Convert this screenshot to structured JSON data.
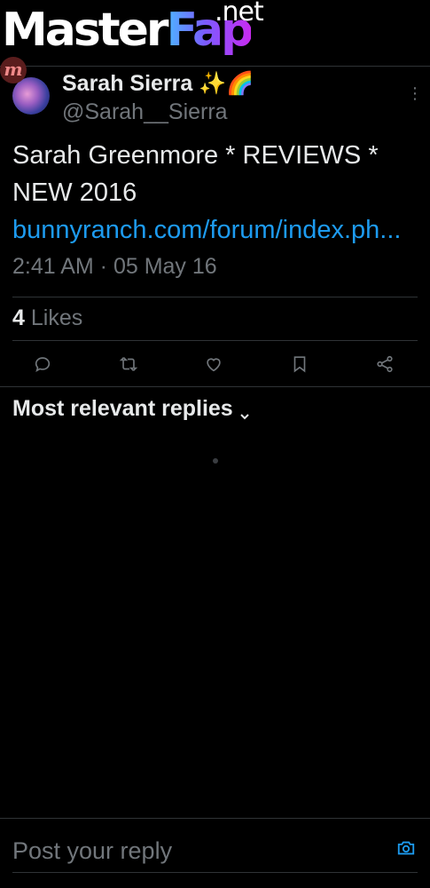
{
  "watermark": {
    "brand_master": "Master",
    "brand_fap": "Fap",
    "tld": ".net",
    "badge": "m"
  },
  "tweet": {
    "author_name": "Sarah Sierra",
    "author_emoji": "✨🌈",
    "handle": "@Sarah__Sierra",
    "text_plain": "Sarah Greenmore * REVIEWS * NEW 2016 ",
    "text_link": "bunnyranch.com/forum/index.ph...",
    "timestamp": "2:41 AM · 05 May 16",
    "likes_count": "4",
    "likes_label": "Likes"
  },
  "actions": {
    "reply": "reply-icon",
    "retweet": "retweet-icon",
    "like": "heart-icon",
    "bookmark": "bookmark-icon",
    "share": "share-icon"
  },
  "replies": {
    "sort_label": "Most relevant replies"
  },
  "composer": {
    "placeholder": "Post your reply"
  },
  "colors": {
    "accent": "#1d9bf0",
    "background": "#000000",
    "muted": "#71767b",
    "text": "#e7e9ea"
  }
}
